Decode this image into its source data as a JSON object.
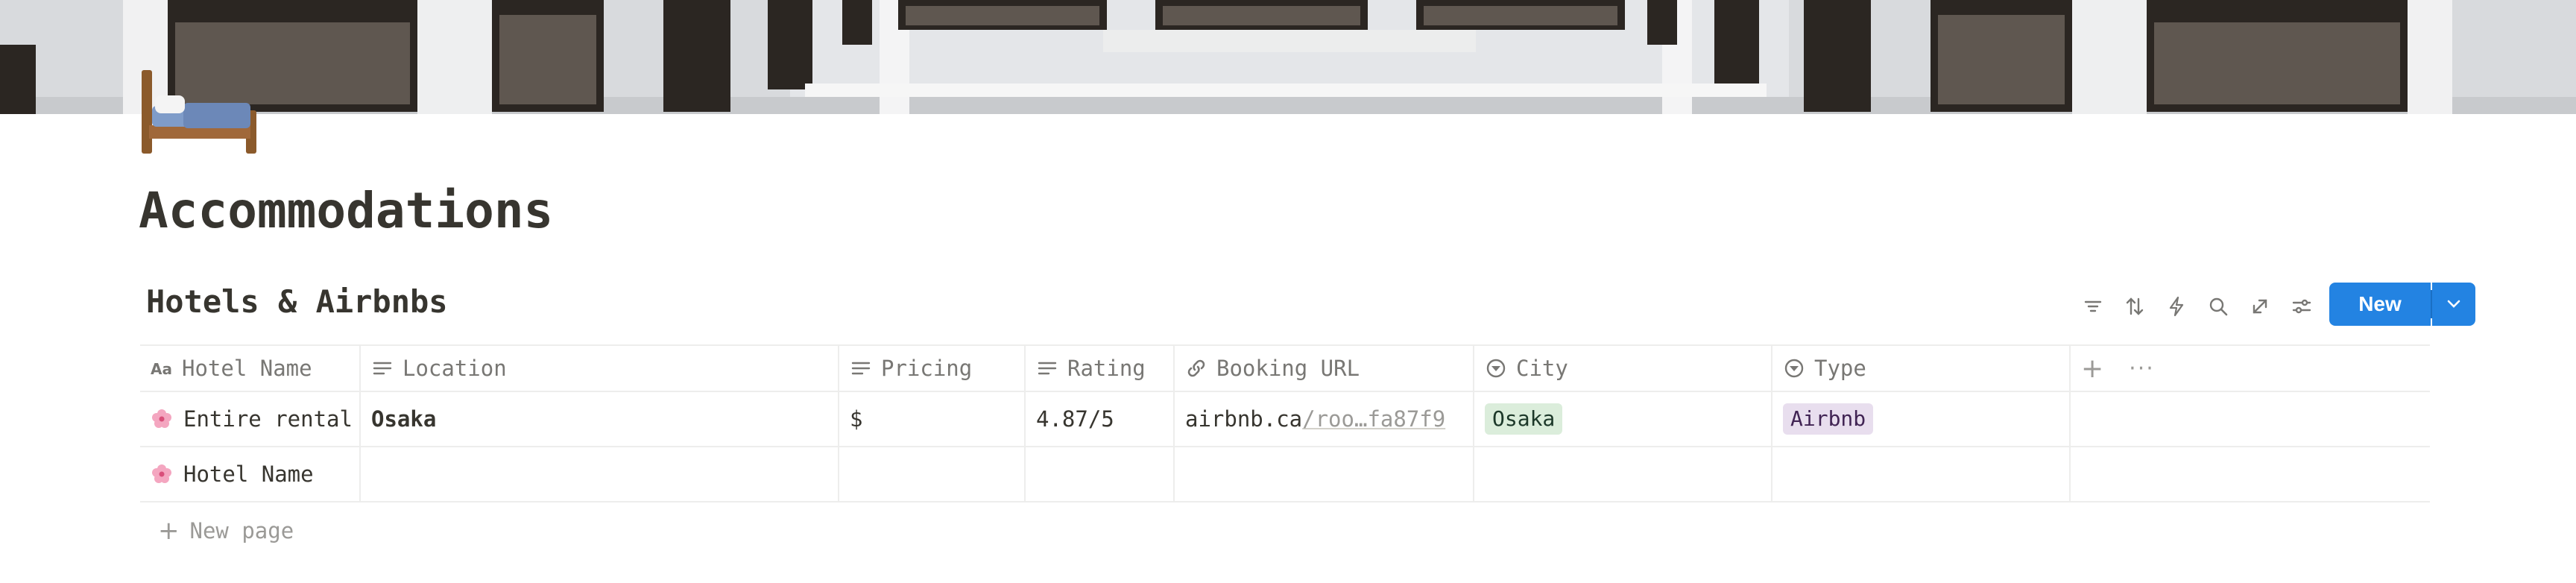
{
  "page": {
    "title": "Accommodations",
    "icon": "bed-icon"
  },
  "database": {
    "title": "Hotels & Airbnbs",
    "toolbar": {
      "icons": [
        "filter-icon",
        "sort-icon",
        "automation-icon",
        "search-icon",
        "expand-icon",
        "settings-icon"
      ],
      "new_label": "New"
    },
    "columns": [
      {
        "label": "Hotel Name",
        "icon": "title-icon"
      },
      {
        "label": "Location",
        "icon": "text-icon"
      },
      {
        "label": "Pricing",
        "icon": "text-icon"
      },
      {
        "label": "Rating",
        "icon": "text-icon"
      },
      {
        "label": "Booking URL",
        "icon": "link-icon"
      },
      {
        "label": "City",
        "icon": "select-icon"
      },
      {
        "label": "Type",
        "icon": "select-icon"
      }
    ],
    "rows": [
      {
        "hotel_name": "Entire rental",
        "location": "Osaka",
        "pricing": "$",
        "rating": "4.87/5",
        "booking_url_host": "airbnb.ca",
        "booking_url_path": "/roo…fa87f9",
        "city": "Osaka",
        "type": "Airbnb"
      },
      {
        "hotel_name": "Hotel Name"
      }
    ],
    "new_page_label": "New page"
  },
  "colors": {
    "accent": "#2383e2",
    "city_tag_bg": "#dbeddb",
    "type_tag_bg": "#e8deee",
    "row_emoji": "#f4a6c0"
  }
}
